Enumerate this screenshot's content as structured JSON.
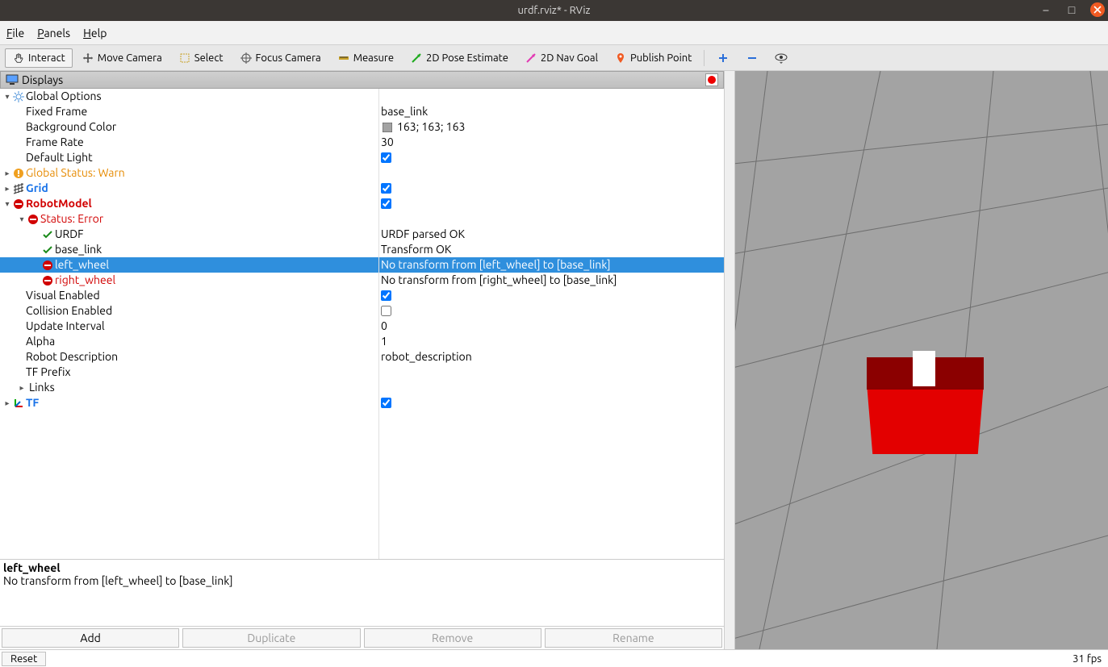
{
  "window": {
    "title": "urdf.rviz* - RViz"
  },
  "menu": {
    "file": "File",
    "panels": "Panels",
    "help": "Help"
  },
  "toolbar": {
    "interact": "Interact",
    "move_camera": "Move Camera",
    "select": "Select",
    "focus_camera": "Focus Camera",
    "measure": "Measure",
    "pose_estimate": "2D Pose Estimate",
    "nav_goal": "2D Nav Goal",
    "publish_point": "Publish Point"
  },
  "panel": {
    "title": "Displays",
    "global_options": "Global Options",
    "fixed_frame": {
      "k": "Fixed Frame",
      "v": "base_link"
    },
    "bg_color": {
      "k": "Background Color",
      "v": "163; 163; 163"
    },
    "frame_rate": {
      "k": "Frame Rate",
      "v": "30"
    },
    "default_light": {
      "k": "Default Light",
      "checked": true
    },
    "global_status": "Global Status: Warn",
    "grid": {
      "k": "Grid",
      "checked": true
    },
    "robotmodel": {
      "k": "RobotModel",
      "checked": true
    },
    "status_error": "Status: Error",
    "urdf": {
      "k": "URDF",
      "v": "URDF parsed OK"
    },
    "base_link": {
      "k": "base_link",
      "v": "Transform OK"
    },
    "left_wheel": {
      "k": "left_wheel",
      "v": "No transform from [left_wheel] to [base_link]"
    },
    "right_wheel": {
      "k": "right_wheel",
      "v": "No transform from [right_wheel] to [base_link]"
    },
    "visual_enabled": {
      "k": "Visual Enabled",
      "checked": true
    },
    "collision_enabled": {
      "k": "Collision Enabled",
      "checked": false
    },
    "update_interval": {
      "k": "Update Interval",
      "v": "0"
    },
    "alpha": {
      "k": "Alpha",
      "v": "1"
    },
    "robot_description": {
      "k": "Robot Description",
      "v": "robot_description"
    },
    "tf_prefix": {
      "k": "TF Prefix",
      "v": ""
    },
    "links": "Links",
    "tf": {
      "k": "TF",
      "checked": true
    }
  },
  "desc": {
    "title": "left_wheel",
    "body": "No transform from [left_wheel] to [base_link]"
  },
  "buttons": {
    "add": "Add",
    "duplicate": "Duplicate",
    "remove": "Remove",
    "rename": "Rename"
  },
  "status": {
    "reset": "Reset",
    "fps": "31 fps"
  },
  "colors": {
    "background": "#a3a3a3",
    "robot_front": "#e30000",
    "robot_top": "#8b0000"
  }
}
